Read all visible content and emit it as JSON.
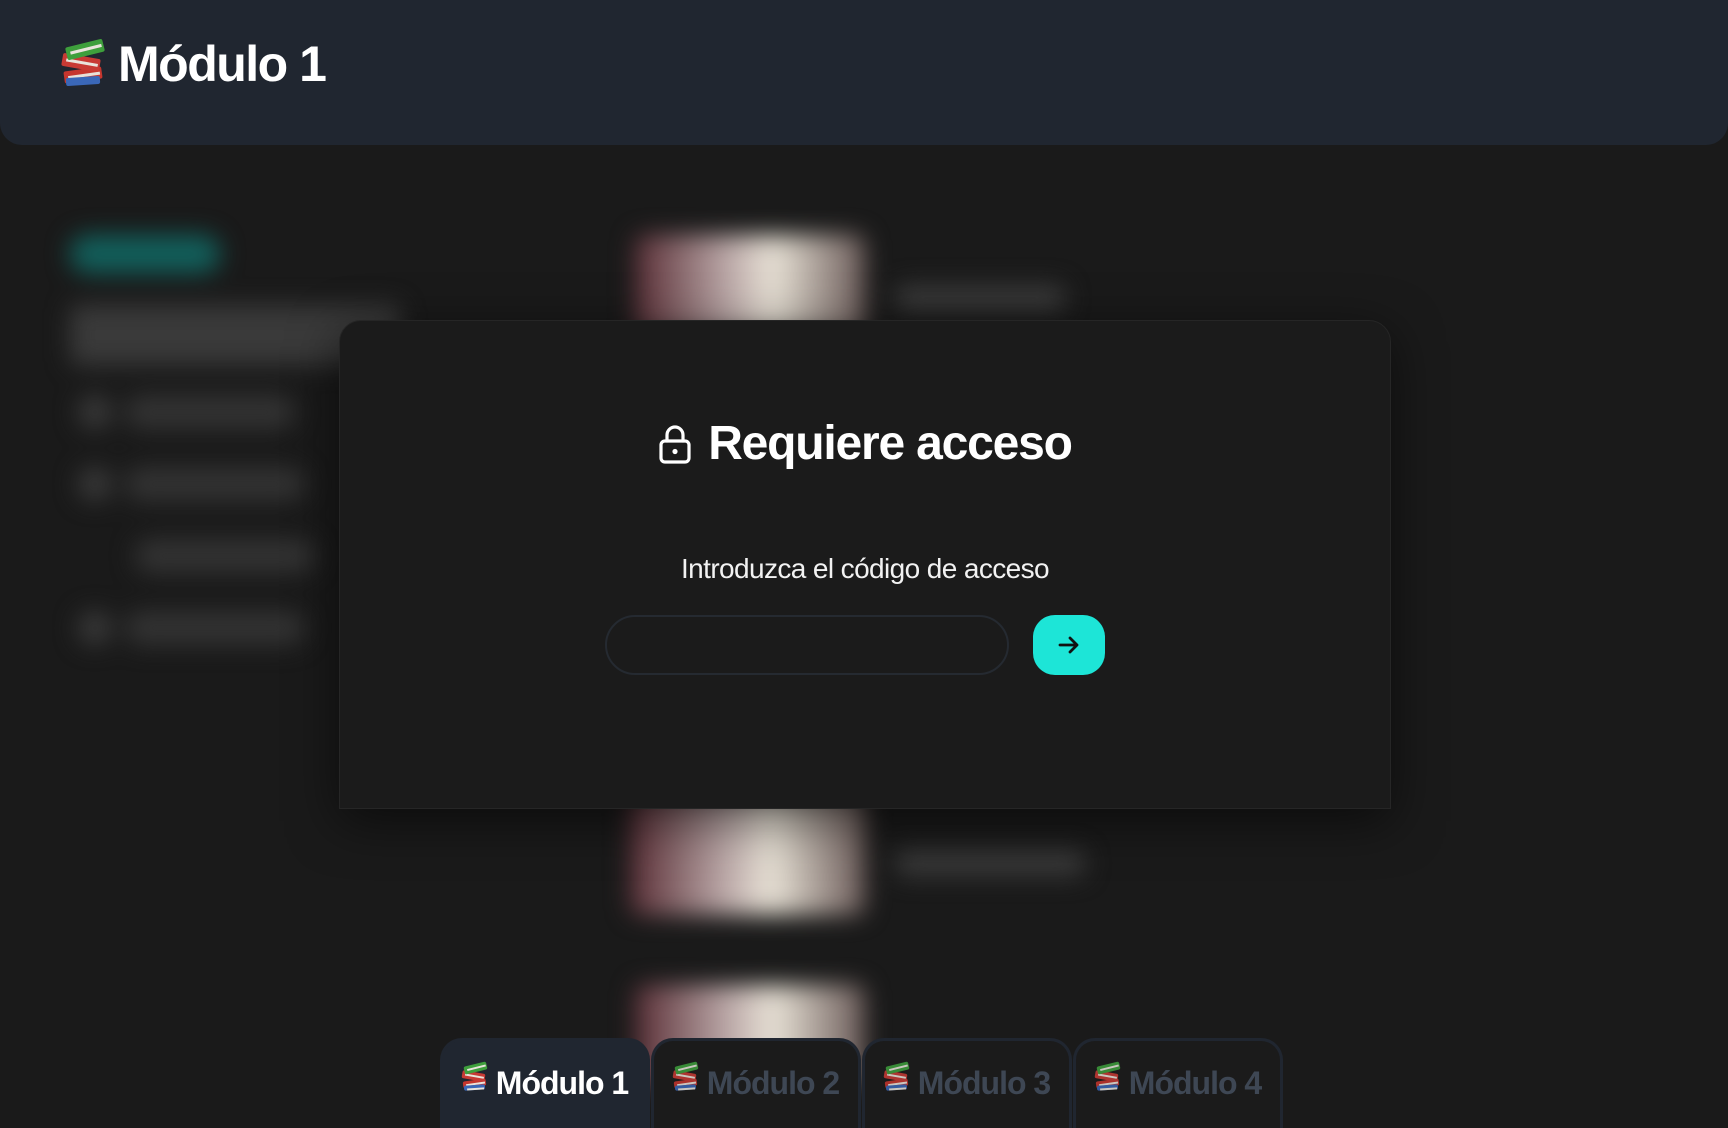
{
  "header": {
    "title": "Módulo 1",
    "icon": "books-icon"
  },
  "modal": {
    "title": "Requiere acceso",
    "title_icon": "lock-icon",
    "label": "Introduzca el código de acceso",
    "input": {
      "value": "",
      "placeholder": ""
    },
    "submit_icon": "arrow-right-icon",
    "accent_color": "#1de5d7"
  },
  "tabs": [
    {
      "label": "Módulo 1",
      "icon": "books-icon",
      "active": true
    },
    {
      "label": "Módulo 2",
      "icon": "books-icon",
      "active": false
    },
    {
      "label": "Módulo 3",
      "icon": "books-icon",
      "active": false
    },
    {
      "label": "Módulo 4",
      "icon": "books-icon",
      "active": false
    }
  ],
  "colors": {
    "background": "#1a1a1a",
    "header": "#202630",
    "accent": "#1de5d7",
    "inactive_tab_text": "#3e4754"
  }
}
